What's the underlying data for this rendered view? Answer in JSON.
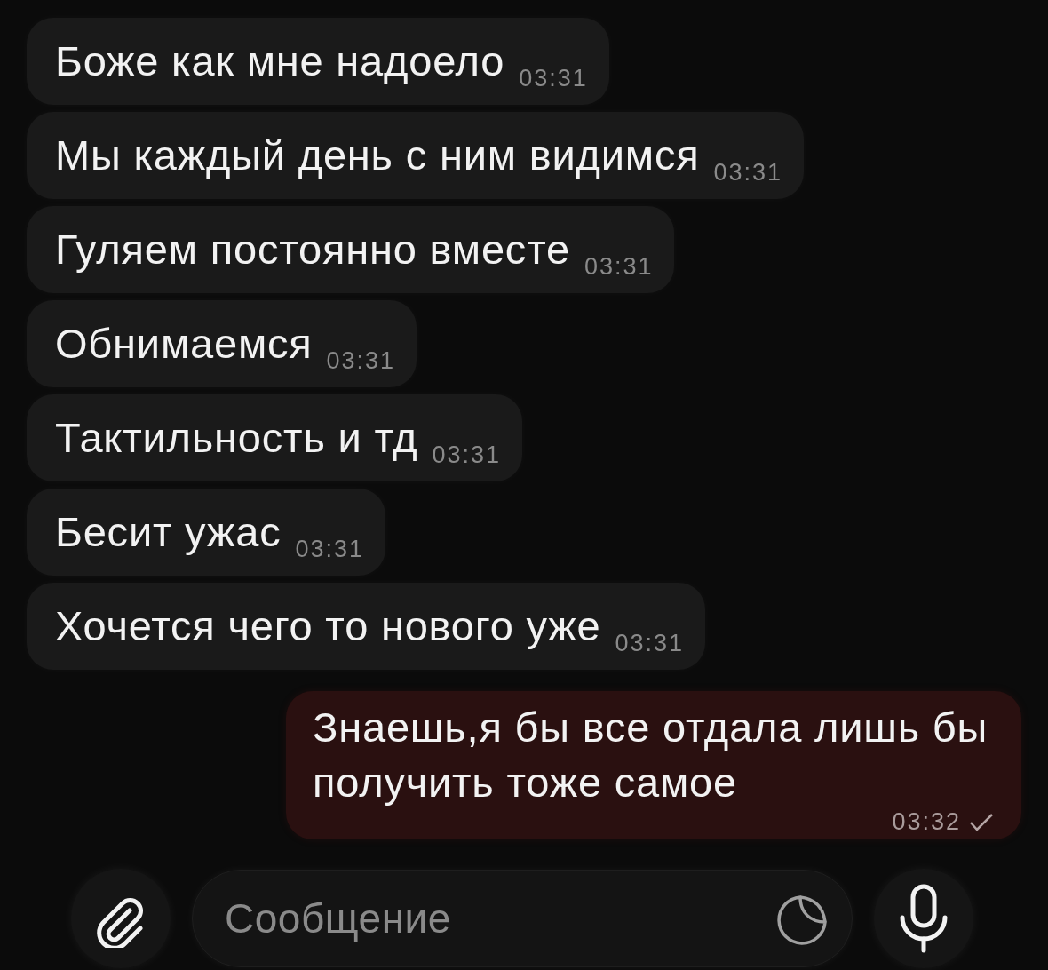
{
  "messages": [
    {
      "kind": "incoming",
      "text": "Боже как мне надоело",
      "time": "03:31"
    },
    {
      "kind": "incoming",
      "text": "Мы каждый день с ним видимся",
      "time": "03:31"
    },
    {
      "kind": "incoming",
      "text": "Гуляем постоянно вместе",
      "time": "03:31"
    },
    {
      "kind": "incoming",
      "text": "Обнимаемся",
      "time": "03:31"
    },
    {
      "kind": "incoming",
      "text": "Тактильность и тд",
      "time": "03:31"
    },
    {
      "kind": "incoming",
      "text": "Бесит ужас",
      "time": "03:31"
    },
    {
      "kind": "incoming",
      "text": "Хочется чего то нового уже",
      "time": "03:31"
    },
    {
      "kind": "outgoing",
      "text": "Знаешь,я бы все отдала лишь бы получить тоже самое",
      "time": "03:32",
      "read": false
    }
  ],
  "composer": {
    "placeholder": "Сообщение"
  }
}
